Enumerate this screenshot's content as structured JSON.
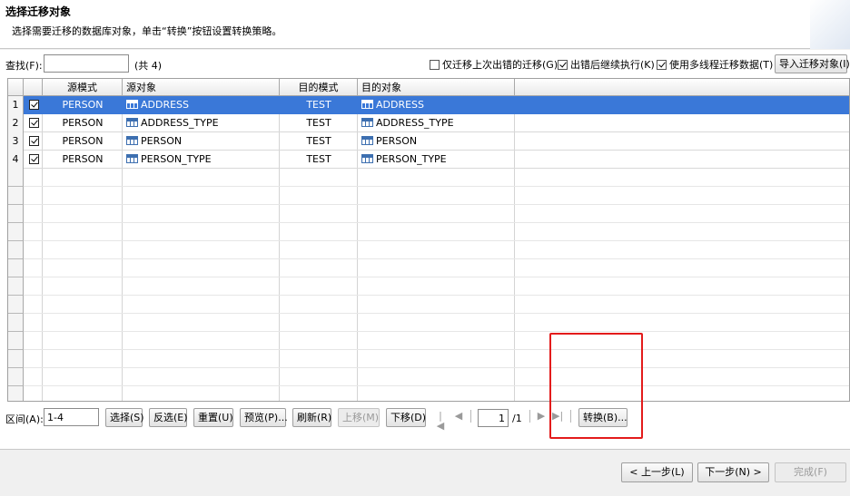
{
  "header": {
    "title": "选择迁移对象",
    "subtitle": "选择需要迁移的数据库对象，单击“转换”按钮设置转换策略。"
  },
  "toolbar": {
    "search_label": "查找(F):",
    "search_value": "",
    "count_text": "(共 4)",
    "only_failed_label": "仅迁移上次出错的迁移(G)",
    "continue_on_error_label": "出错后继续执行(K)",
    "multithread_label": "使用多线程迁移数据(T)",
    "import_button": "导入迁移对象(I)"
  },
  "table": {
    "columns": [
      "源模式",
      "源对象",
      "目的模式",
      "目的对象"
    ],
    "rows": [
      {
        "num": "1",
        "source_schema": "PERSON",
        "source_object": "ADDRESS",
        "target_schema": "TEST",
        "target_object": "ADDRESS",
        "checked": true,
        "selected": true
      },
      {
        "num": "2",
        "source_schema": "PERSON",
        "source_object": "ADDRESS_TYPE",
        "target_schema": "TEST",
        "target_object": "ADDRESS_TYPE",
        "checked": true,
        "selected": false
      },
      {
        "num": "3",
        "source_schema": "PERSON",
        "source_object": "PERSON",
        "target_schema": "TEST",
        "target_object": "PERSON",
        "checked": true,
        "selected": false
      },
      {
        "num": "4",
        "source_schema": "PERSON",
        "source_object": "PERSON_TYPE",
        "target_schema": "TEST",
        "target_object": "PERSON_TYPE",
        "checked": true,
        "selected": false
      }
    ]
  },
  "bottom": {
    "range_label": "区间(A):",
    "range_value": "1-4",
    "select_button": "选择(S)",
    "invert_button": "反选(E)",
    "reset_button": "重置(U)",
    "preview_button": "预览(P)...",
    "refresh_button": "刷新(R)",
    "move_up_button": "上移(M)",
    "move_down_button": "下移(D)",
    "page_value": "1",
    "page_total": "/1",
    "convert_button": "转换(B)..."
  },
  "footer": {
    "prev_button": "< 上一步(L)",
    "next_button": "下一步(N) >",
    "finish_button": "完成(F)"
  },
  "colors": {
    "selection": "#3a78d8",
    "highlight_box": "#e31b1b"
  }
}
